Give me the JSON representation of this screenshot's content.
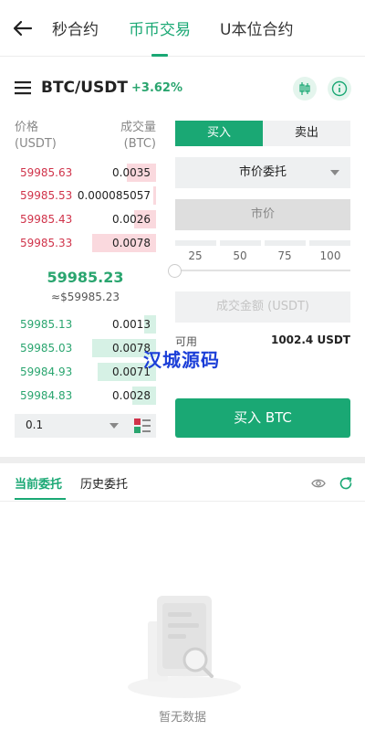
{
  "nav": {
    "tabs": [
      "秒合约",
      "币币交易",
      "U本位合约"
    ],
    "active_index": 1
  },
  "pair": {
    "name": "BTC/USDT",
    "change": "+3.62%"
  },
  "orderbook": {
    "price_header": [
      "价格",
      "(USDT)"
    ],
    "qty_header": [
      "成交量",
      "(BTC)"
    ],
    "asks": [
      {
        "price": "59985.63",
        "qty": "0.0035",
        "depth": 0.45
      },
      {
        "price": "59985.53",
        "qty": "0.000085057",
        "depth": 0.02
      },
      {
        "price": "59985.43",
        "qty": "0.0026",
        "depth": 0.34
      },
      {
        "price": "59985.33",
        "qty": "0.0078",
        "depth": 1.0
      }
    ],
    "last_price": "59985.23",
    "last_price_usd": "≈$59985.23",
    "bids": [
      {
        "price": "59985.13",
        "qty": "0.0013",
        "depth": 0.18
      },
      {
        "price": "59985.03",
        "qty": "0.0078",
        "depth": 1.0
      },
      {
        "price": "59984.93",
        "qty": "0.0071",
        "depth": 0.92
      },
      {
        "price": "59984.83",
        "qty": "0.0028",
        "depth": 0.37
      }
    ],
    "depth_step": "0.1"
  },
  "trade": {
    "buy_tab": "买入",
    "sell_tab": "卖出",
    "order_type": "市价委托",
    "price_placeholder": "市价",
    "percents": [
      "25",
      "50",
      "75",
      "100"
    ],
    "amount_placeholder": "成交金额 (USDT)",
    "available_label": "可用",
    "available_value": "1002.4 USDT",
    "submit": "买入 BTC"
  },
  "watermark": "汉城源码",
  "orders": {
    "tabs": [
      "当前委托",
      "历史委托"
    ],
    "empty_text": "暂无数据"
  },
  "colors": {
    "accent": "#1aa874",
    "sell": "#d0334a",
    "buy": "#2aa56f"
  }
}
